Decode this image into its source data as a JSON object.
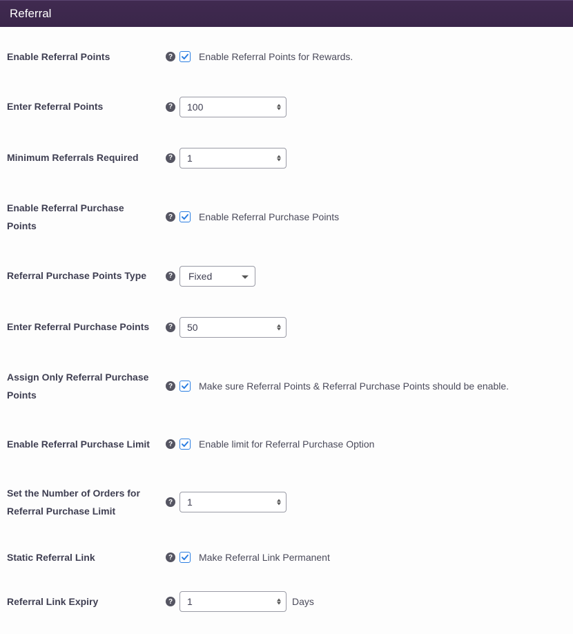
{
  "header": {
    "title": "Referral"
  },
  "rows": {
    "enable_referral_points": {
      "label": "Enable Referral Points",
      "desc": "Enable Referral Points for Rewards.",
      "checked": true
    },
    "enter_referral_points": {
      "label": "Enter Referral Points",
      "value": "100"
    },
    "min_referrals": {
      "label": "Minimum Referrals Required",
      "value": "1"
    },
    "enable_referral_purchase": {
      "label": "Enable Referral Purchase Points",
      "desc": "Enable Referral Purchase Points",
      "checked": true
    },
    "purchase_points_type": {
      "label": "Referral Purchase Points Type",
      "value": "Fixed",
      "options": [
        "Fixed"
      ]
    },
    "enter_purchase_points": {
      "label": "Enter Referral Purchase Points",
      "value": "50"
    },
    "assign_only": {
      "label": "Assign Only Referral Purchase Points",
      "desc": "Make sure Referral Points & Referral Purchase Points should be enable.",
      "checked": true
    },
    "enable_limit": {
      "label": "Enable Referral Purchase Limit",
      "desc": "Enable limit for Referral Purchase Option",
      "checked": true
    },
    "orders_limit": {
      "label": "Set the Number of Orders for Referral Purchase Limit",
      "value": "1"
    },
    "static_link": {
      "label": "Static Referral Link",
      "desc": "Make Referral Link Permanent",
      "checked": true
    },
    "link_expiry": {
      "label": "Referral Link Expiry",
      "value": "1",
      "unit": "Days"
    }
  }
}
